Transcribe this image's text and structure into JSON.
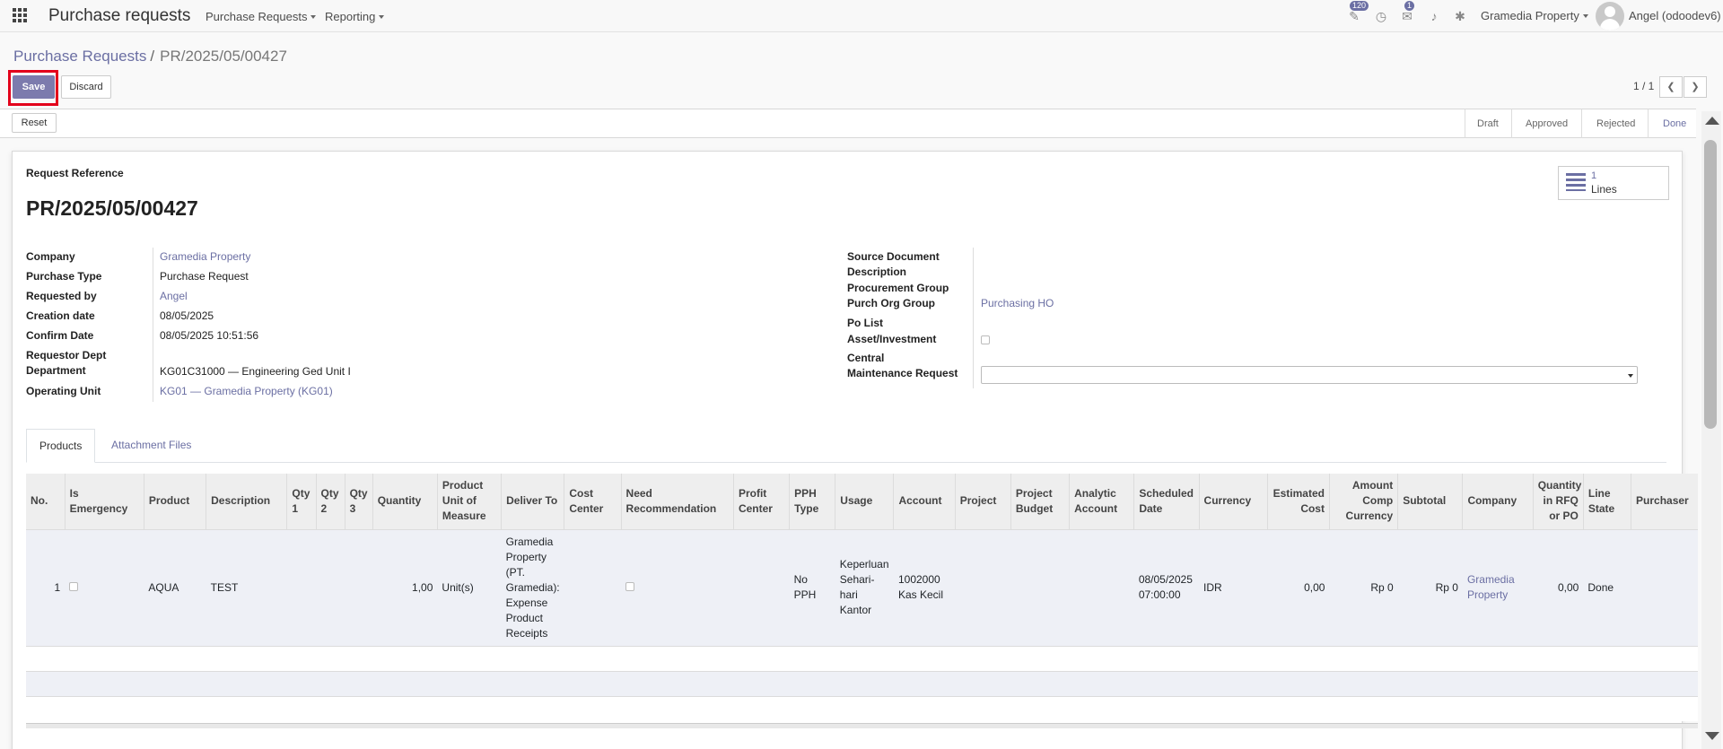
{
  "navbar": {
    "app_title": "Purchase requests",
    "menus": [
      "Purchase Requests",
      "Reporting"
    ],
    "badges": {
      "activities": "120",
      "messages": "1"
    },
    "company_switcher": "Gramedia Property",
    "user": "Angel (odoodev6)"
  },
  "breadcrumb": {
    "parent": "Purchase Requests",
    "separator": "/",
    "current": "PR/2025/05/00427"
  },
  "buttons": {
    "save": "Save",
    "discard": "Discard",
    "reset": "Reset"
  },
  "pager": {
    "value": "1 / 1"
  },
  "stages": [
    "Draft",
    "Approved",
    "Rejected",
    "Done"
  ],
  "active_stage": "Done",
  "form": {
    "ref_label": "Request Reference",
    "ref_value": "PR/2025/05/00427",
    "smart_button": {
      "count": "1",
      "label": "Lines"
    },
    "left": {
      "company_label": "Company",
      "company_value": "Gramedia Property",
      "purchase_type_label": "Purchase Type",
      "purchase_type_value": "Purchase Request",
      "requested_by_label": "Requested by",
      "requested_by_value": "Angel",
      "creation_date_label": "Creation date",
      "creation_date_value": "08/05/2025",
      "confirm_date_label": "Confirm Date",
      "confirm_date_value": "08/05/2025 10:51:56",
      "dept_label_1": "Requestor Dept",
      "dept_label_2": "Department",
      "dept_value": "KG01C31000 — Engineering Ged Unit I",
      "operating_unit_label": "Operating Unit",
      "operating_unit_value": "KG01 — Gramedia Property (KG01)"
    },
    "right": {
      "source_document_label": "Source Document",
      "description_label": "Description",
      "procurement_group_label": "Procurement Group",
      "purch_org_group_label": "Purch Org Group",
      "purch_org_group_value": "Purchasing HO",
      "po_list_label": "Po List",
      "asset_label": "Asset/Investment",
      "central_label_1": "Central",
      "central_label_2": "Maintenance Request"
    }
  },
  "tabs": [
    "Products",
    "Attachment Files"
  ],
  "table": {
    "headers": [
      "No.",
      "Is Emergency",
      "Product",
      "Description",
      "Qty 1",
      "Qty 2",
      "Qty 3",
      "Quantity",
      "Product Unit of Measure",
      "Deliver To",
      "Cost Center",
      "Need Recommendation",
      "Profit Center",
      "PPH Type",
      "Usage",
      "Account",
      "Project",
      "Project Budget",
      "Analytic Account",
      "Scheduled Date",
      "Currency",
      "Estimated Cost",
      "Amount Comp Currency",
      "Subtotal",
      "Company",
      "Quantity in RFQ or PO",
      "Line State",
      "Purchaser"
    ],
    "row": {
      "no": "1",
      "product": "AQUA",
      "description": "TEST",
      "quantity": "1,00",
      "uom": "Unit(s)",
      "deliver_to": "Gramedia Property (PT. Gramedia): Expense Product Receipts",
      "pph_type": "No PPH",
      "usage": "Keperluan Sehari-hari Kantor",
      "account": "1002000 Kas Kecil",
      "scheduled_date": "08/05/2025 07:00:00",
      "currency": "IDR",
      "estimated_cost": "0,00",
      "amount_comp": "Rp 0",
      "subtotal": "Rp 0",
      "company": "Gramedia Property",
      "qty_rfq": "0,00",
      "line_state": "Done"
    }
  },
  "colors": {
    "accent": "#6b6fa3",
    "primary_button": "#7c7bad",
    "highlight": "#e3001b"
  }
}
